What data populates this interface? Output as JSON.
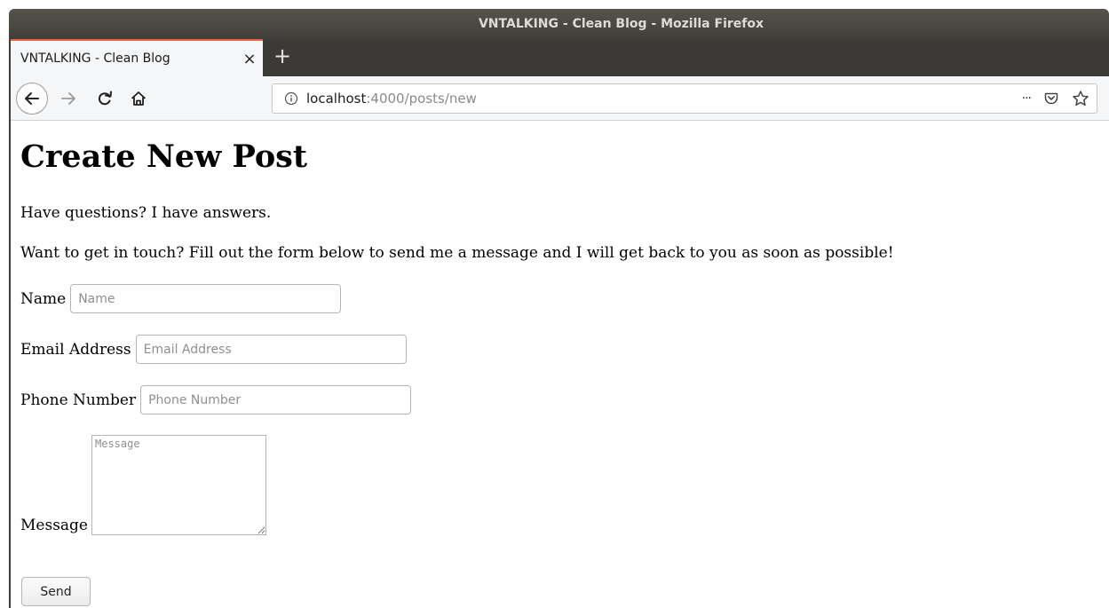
{
  "window": {
    "title": "VNTALKING - Clean Blog - Mozilla Firefox"
  },
  "tab": {
    "title": "VNTALKING - Clean Blog",
    "close": "×",
    "new_tab": "+"
  },
  "urlbar": {
    "host": "localhost",
    "rest": ":4000/posts/new",
    "more": "···"
  },
  "icons": {
    "back": "back-arrow-icon",
    "forward": "forward-arrow-icon",
    "reload": "reload-icon",
    "home": "home-icon",
    "info": "info-icon",
    "pocket": "pocket-icon",
    "bookmark": "star-icon"
  },
  "page": {
    "heading": "Create New Post",
    "intro": "Have questions? I have answers.",
    "description": "Want to get in touch? Fill out the form below to send me a message and I will get back to you as soon as possible!",
    "form": {
      "name_label": "Name",
      "name_placeholder": "Name",
      "email_label": "Email Address",
      "email_placeholder": "Email Address",
      "phone_label": "Phone Number",
      "phone_placeholder": "Phone Number",
      "message_label": "Message",
      "message_placeholder": "Message",
      "send_label": "Send"
    }
  },
  "colors": {
    "titlebar": "#403e3a",
    "tab_accent": "#e8643c",
    "toolbar": "#f5f6f7"
  }
}
